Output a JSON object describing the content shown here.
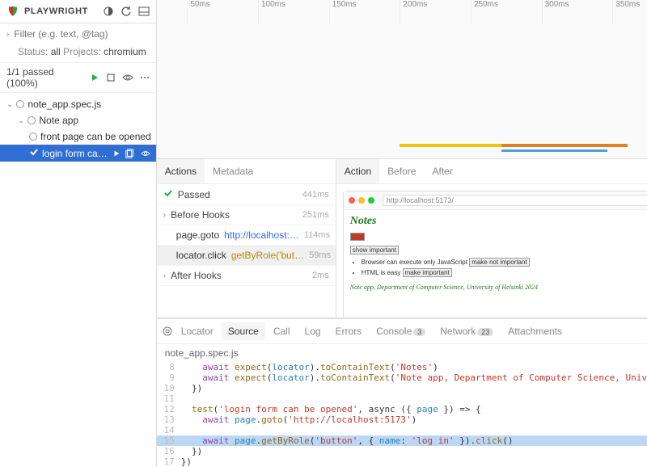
{
  "brand": "PLAYWRIGHT",
  "filter": {
    "placeholder": "Filter (e.g. text, @tag)"
  },
  "status": {
    "label": "Status:",
    "value": "all",
    "projects_label": "Projects:",
    "projects_value": "chromium"
  },
  "counter": "1/1 passed (100%)",
  "tree": {
    "file": "note_app.spec.js",
    "describe": "Note app",
    "test1": "front page can be opened",
    "test2": "login form ca…"
  },
  "timeline_ticks": [
    "50ms",
    "100ms",
    "150ms",
    "200ms",
    "250ms",
    "300ms",
    "350ms"
  ],
  "actions_tabs": {
    "actions": "Actions",
    "metadata": "Metadata"
  },
  "actions": {
    "passed": {
      "label": "Passed",
      "time": "441ms"
    },
    "before": {
      "label": "Before Hooks",
      "time": "251ms"
    },
    "goto": {
      "prefix": "page.goto ",
      "link": "http://localhost:…",
      "time": "114ms"
    },
    "click": {
      "prefix": "locator.click ",
      "locator": "getByRole('but…",
      "time": "59ms"
    },
    "after": {
      "label": "After Hooks",
      "time": "2ms"
    }
  },
  "preview_tabs": {
    "action": "Action",
    "before": "Before",
    "after": "After"
  },
  "preview": {
    "url": "http://localhost:5173/",
    "heading": "Notes",
    "show_important": "show important",
    "note1_text": "Browser can execute only JavaScript",
    "note1_btn": "make not important",
    "note2_text": "HTML is easy",
    "note2_btn": "make important",
    "footer": "Note app, Department of Computer Science, University of Helsinki 2024"
  },
  "bottom_tabs": {
    "locator": "Locator",
    "source": "Source",
    "call": "Call",
    "log": "Log",
    "errors": "Errors",
    "console": "Console",
    "console_badge": "3",
    "network": "Network",
    "network_badge": "23",
    "attachments": "Attachments"
  },
  "source_file": "note_app.spec.js",
  "code": {
    "ln8": "8",
    "l8a": "    await ",
    "l8b": "expect",
    "l8c": "(",
    "l8d": "locator",
    "l8e": ").",
    "l8f": "toContainText",
    "l8g": "(",
    "l8h": "'Notes'",
    "l8i": ")",
    "ln9": "9",
    "l9a": "    await ",
    "l9b": "expect",
    "l9c": "(",
    "l9d": "locator",
    "l9e": ").",
    "l9f": "toContainText",
    "l9g": "(",
    "l9h": "'Note app, Department of Computer Science, Univers",
    "ln10": "10",
    "l10": "  })",
    "ln11": "11",
    "l11": "",
    "ln12": "12",
    "l12a": "  test",
    "l12b": "(",
    "l12c": "'login form can be opened'",
    "l12d": ", async ({ ",
    "l12e": "page",
    "l12f": " }) => {",
    "ln13": "13",
    "l13a": "    await ",
    "l13b": "page",
    "l13c": ".",
    "l13d": "goto",
    "l13e": "(",
    "l13f": "'http://localhost:5173'",
    "l13g": ")",
    "ln14": "14",
    "l14": "",
    "ln15": "15",
    "l15a": "    await ",
    "l15b": "page",
    "l15c": ".",
    "l15d": "getByRole",
    "l15e": "(",
    "l15f": "'button'",
    "l15g": ", { ",
    "l15h": "name",
    "l15i": ": ",
    "l15j": "'log in'",
    "l15k": " }).",
    "l15l": "click",
    "l15m": "()",
    "ln16": "16",
    "l16": "  })",
    "ln17": "17",
    "l17": "})"
  }
}
